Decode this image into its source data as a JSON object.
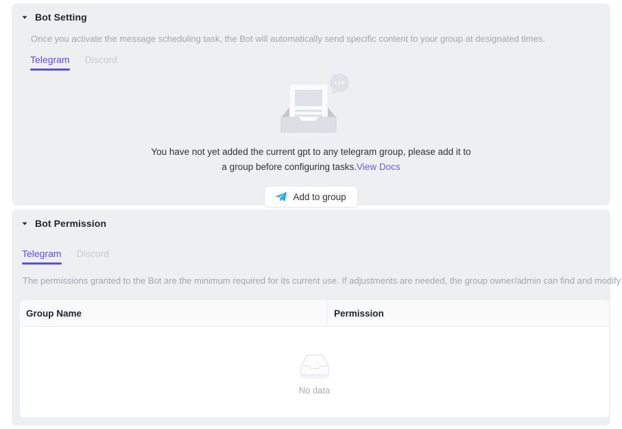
{
  "theme": {
    "accent": "#5b4bf5",
    "link": "#6b5ce7",
    "telegram_blue": "#2aabee",
    "card_bg": "#eeeff1",
    "page_bg": "#ffffff",
    "muted_text": "#a3a6ad"
  },
  "bot_setting": {
    "title": "Bot Setting",
    "chevron_icon": "chevron-down-icon",
    "description": "Once you activate the message scheduling task, the Bot will automatically send specific content to your group at designated times.",
    "tabs": [
      {
        "label": "Telegram",
        "active": true
      },
      {
        "label": "Discord",
        "active": false
      }
    ],
    "empty_state": {
      "illustration_icon": "empty-inbox-message-icon",
      "message": "You have not yet added the current gpt to any telegram group, please add it to a group before configuring tasks.",
      "link_label": "View Docs",
      "button": {
        "label": "Add to group",
        "icon": "telegram-paper-plane-icon"
      }
    }
  },
  "bot_permission": {
    "title": "Bot Permission",
    "chevron_icon": "chevron-down-icon",
    "tabs": [
      {
        "label": "Telegram",
        "active": true
      },
      {
        "label": "Discord",
        "active": false
      }
    ],
    "description_lines": [
      "The permissions granted to the Bot are the minimum required for its current use.",
      "If adjustments are needed, the group owner/admin can find and modify the PeaAIBot settings in the Group info."
    ],
    "table": {
      "columns": [
        "Group Name",
        "Permission"
      ],
      "rows": [],
      "empty": {
        "icon": "empty-tray-icon",
        "label": "No data"
      }
    }
  }
}
